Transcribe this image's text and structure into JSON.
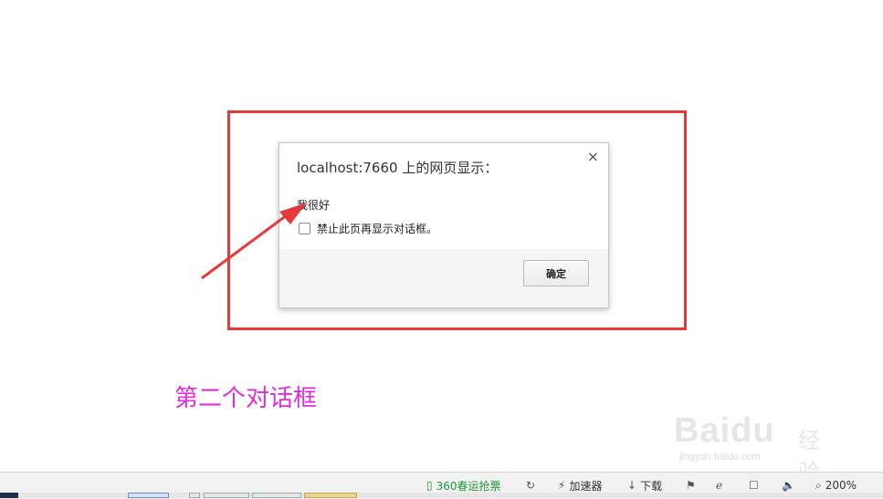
{
  "dialog": {
    "title": "localhost:7660 上的网页显示：",
    "close_icon": "×",
    "message": "我很好",
    "checkbox_label": "禁止此页再显示对话框。",
    "checkbox_checked": false,
    "ok_label": "确定"
  },
  "annotation": {
    "caption": "第二个对话框",
    "highlight_color": "#e8393a",
    "caption_color": "#dd2ed9"
  },
  "watermark": {
    "brand": "Baidu",
    "suffix": "经验",
    "url": "jingyan.baidu.com"
  },
  "statusbar": {
    "items": [
      {
        "icon": "phone-icon",
        "label": "360春运抢票"
      },
      {
        "icon": "refresh-icon",
        "label": ""
      },
      {
        "icon": "accelerator-icon",
        "label": "加速器"
      },
      {
        "icon": "download-icon",
        "label": "下载"
      },
      {
        "icon": "flag-icon",
        "label": ""
      },
      {
        "icon": "ie-icon",
        "label": ""
      },
      {
        "icon": "window-icon",
        "label": ""
      },
      {
        "icon": "speaker-icon",
        "label": ""
      },
      {
        "icon": "zoom-icon",
        "label": "200%"
      }
    ]
  }
}
